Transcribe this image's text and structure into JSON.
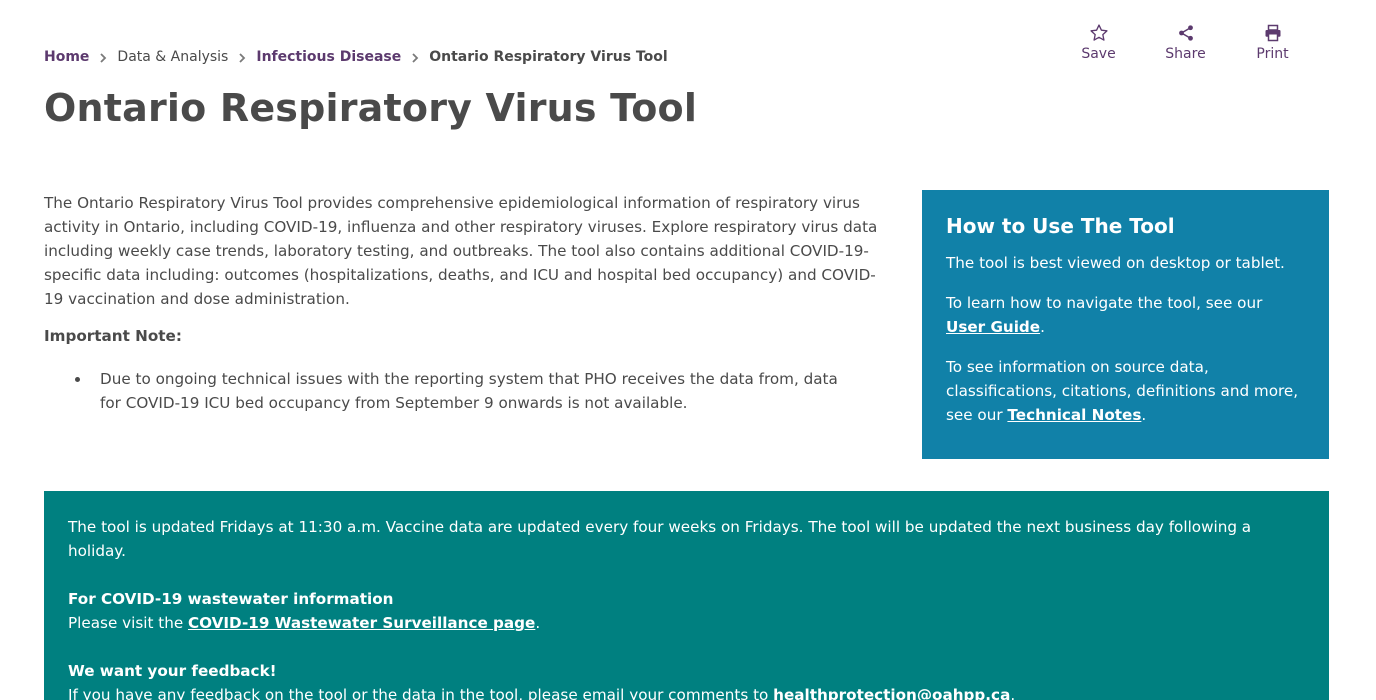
{
  "breadcrumb": {
    "home": "Home",
    "data_analysis": "Data & Analysis",
    "infectious_disease": "Infectious Disease",
    "current": "Ontario Respiratory Virus Tool"
  },
  "actions": {
    "save": "Save",
    "share": "Share",
    "print": "Print"
  },
  "page_title": "Ontario Respiratory Virus Tool",
  "intro": "The Ontario Respiratory Virus Tool provides comprehensive epidemiological information of respiratory virus activity in Ontario, including COVID-19, influenza and other respiratory viruses. Explore respiratory virus data including weekly case trends, laboratory testing, and outbreaks. The tool also contains additional COVID-19-specific data including: outcomes (hospitalizations, deaths, and ICU and hospital bed occupancy) and COVID-19 vaccination and dose administration.",
  "important_note": {
    "heading": "Important Note:",
    "items": [
      "Due to ongoing technical issues with the reporting system that PHO receives the data from, data for COVID-19 ICU bed occupancy from September 9 onwards is not available."
    ]
  },
  "how_to": {
    "heading": "How to Use The Tool",
    "p1": "The tool is best viewed on desktop or tablet.",
    "p2_prefix": "To learn how to navigate the tool, see our ",
    "p2_link": "User Guide",
    "p2_suffix": ".",
    "p3_prefix": "To see information on source data, classifications, citations, definitions and more, see our ",
    "p3_link": "Technical Notes",
    "p3_suffix": "."
  },
  "banner": {
    "update_text": "The tool is updated Fridays at 11:30 a.m. Vaccine data are updated every four weeks on Fridays. The tool will be updated the next business day following a holiday.",
    "wastewater_heading": "For COVID-19 wastewater information",
    "wastewater_prefix": "Please visit the ",
    "wastewater_link": "COVID-19 Wastewater Surveillance page",
    "wastewater_suffix": ".",
    "feedback_heading": "We want your feedback!",
    "feedback_prefix": "If you have any feedback on the tool or the data in the tool, please email your comments to ",
    "feedback_link": "healthprotection@oahpp.ca",
    "feedback_suffix": "."
  },
  "colors": {
    "accent_purple": "#5c3a6e",
    "howto_bg": "#1181a8",
    "banner_bg": "#008080",
    "text": "#4a4a4a"
  },
  "icons": {
    "save": "star-icon",
    "share": "share-icon",
    "print": "printer-icon",
    "separator": "chevron-right-icon"
  }
}
